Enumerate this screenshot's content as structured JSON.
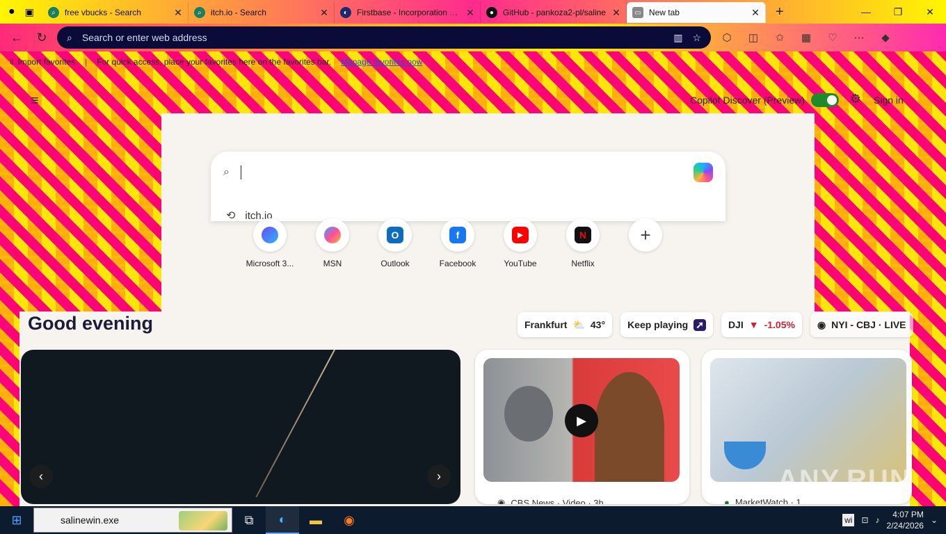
{
  "tabs": [
    {
      "label": "free vbucks - Search",
      "icon": "search-icon"
    },
    {
      "label": "itch.io - Search",
      "icon": "search-icon"
    },
    {
      "label": "Firstbase - Incorporation Flo",
      "icon": "firstbase-icon"
    },
    {
      "label": "GitHub - pankoza2-pl/saline",
      "icon": "github-icon"
    },
    {
      "label": "New tab",
      "icon": "newtab-icon",
      "active": true
    }
  ],
  "address": {
    "placeholder": "Search or enter web address"
  },
  "favbar": {
    "import": "Import favorites",
    "hint": "For quick access, place your favorites here on the favorites bar.",
    "manage": "Manage favorites now"
  },
  "ntp": {
    "copilot_discover": "Copilot Discover (Preview)",
    "sign_in": "Sign in",
    "suggestion": "itch.io",
    "greeting": "Good evening"
  },
  "quick_links": [
    {
      "name": "Microsoft 3...",
      "color": "#6a4cf5",
      "glyph": ""
    },
    {
      "name": "MSN",
      "color": "#2da5ff",
      "glyph": ""
    },
    {
      "name": "Outlook",
      "color": "#0f6cbd",
      "glyph": "O"
    },
    {
      "name": "Facebook",
      "color": "#1877f2",
      "glyph": "f"
    },
    {
      "name": "YouTube",
      "color": "#ff0000",
      "glyph": "▶"
    },
    {
      "name": "Netflix",
      "color": "#e50914",
      "glyph": "N"
    }
  ],
  "chips": {
    "weather_city": "Frankfurt",
    "weather_temp": "43°",
    "game": "Keep playing",
    "stock": "DJI",
    "stock_change": "-1.05%",
    "sports": "NYI - CBJ · LIVE"
  },
  "cards": {
    "video_source": "CBS News · Video · 3h",
    "news_source": "MarketWatch · 1"
  },
  "watermark": "ANY.RUN",
  "taskbar": {
    "search_value": "salinewin.exe",
    "tray_app": "wi",
    "time": "4:07 PM",
    "date": "2/24/2026"
  }
}
